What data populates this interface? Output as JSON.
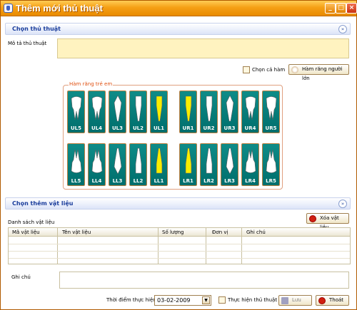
{
  "window": {
    "title": "Thêm mới thủ thuật",
    "minimize": "_",
    "maximize": "□",
    "close": "×"
  },
  "section1": {
    "title": "Chọn thủ thuật",
    "collapse_glyph": "»"
  },
  "procedure": {
    "description_label": "Mô tả thủ thuật",
    "description_value": ""
  },
  "jaw": {
    "full_jaw_label": "Chọn cả hàm",
    "adult_button": "Hàm răng người lớn",
    "group_label": "Hàm răng trẻ em"
  },
  "upper_left": [
    "UL5",
    "UL4",
    "UL3",
    "UL2",
    "UL1"
  ],
  "upper_right": [
    "UR1",
    "UR2",
    "UR3",
    "UR4",
    "UR5"
  ],
  "lower_left": [
    "LL5",
    "LL4",
    "LL3",
    "LL2",
    "LL1"
  ],
  "lower_right": [
    "LR1",
    "LR2",
    "LR3",
    "LR4",
    "LR5"
  ],
  "highlighted_teeth": [
    "UL1",
    "UR1",
    "LL1",
    "LR1"
  ],
  "colors": {
    "tooth_bg": "#0e8c88",
    "highlight": "#f7ee00",
    "tooth_white": "#ffffff",
    "accent": "#1a3d9c"
  },
  "section2": {
    "title": "Chọn thêm vật liệu",
    "collapse_glyph": "»"
  },
  "materials": {
    "list_label": "Danh sách vật liệu",
    "delete_button": "Xóa vật liệu",
    "columns": [
      "Mã vật liệu",
      "Tên vật liệu",
      "Số lượng",
      "Đơn vị",
      "Ghi chú"
    ]
  },
  "notes": {
    "label": "Ghi chú",
    "value": ""
  },
  "footer": {
    "time_label": "Thời điểm thực hiện",
    "date_value": "03-02-2009",
    "performed_label": "Thực hiện thủ thuật",
    "save_button": "Lưu",
    "exit_button": "Thoát"
  }
}
